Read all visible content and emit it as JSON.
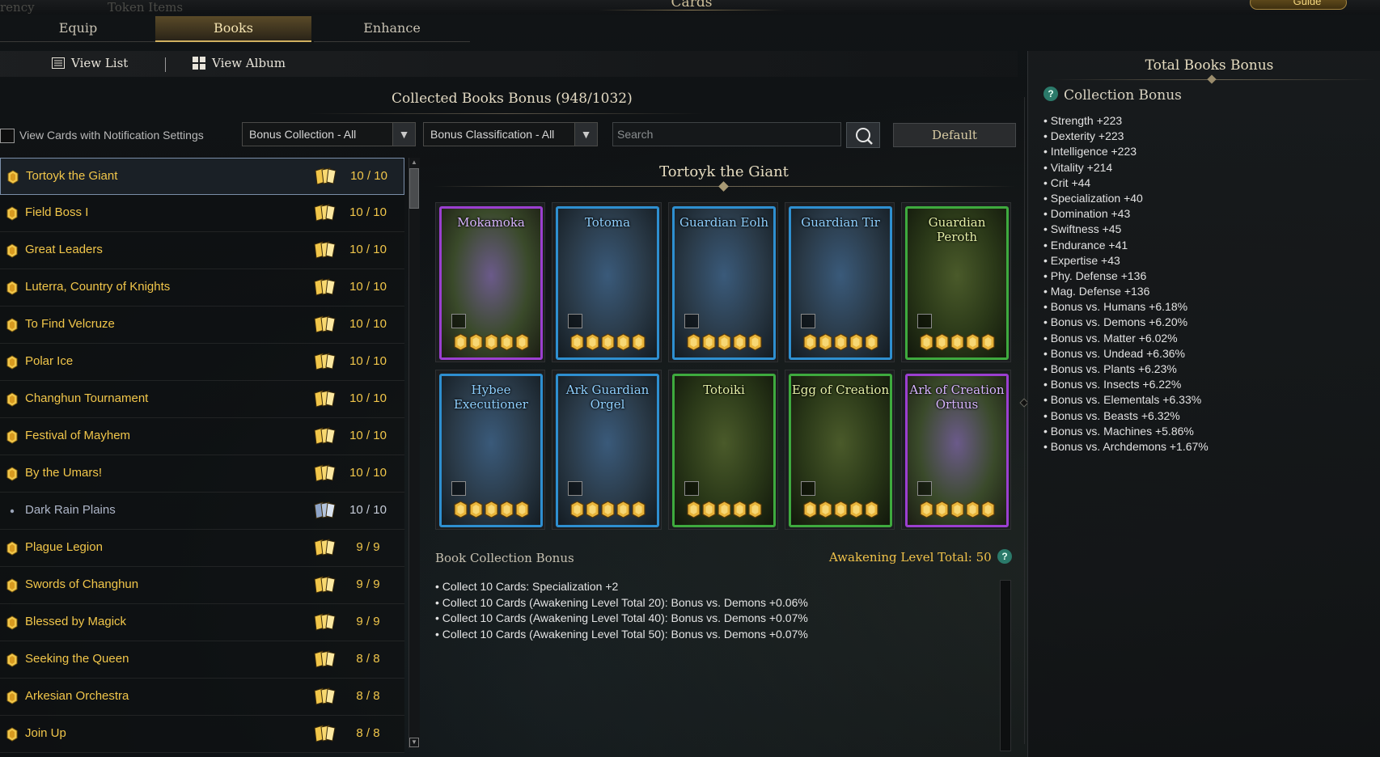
{
  "window": {
    "title": "Cards",
    "guide_label": "Guide",
    "faint_left_1": "rency",
    "faint_left_2": "Token Items"
  },
  "tabs": [
    {
      "label": "Equip",
      "active": false
    },
    {
      "label": "Books",
      "active": true
    },
    {
      "label": "Enhance",
      "active": false
    }
  ],
  "view": {
    "list_label": "View List",
    "album_label": "View Album"
  },
  "collected": {
    "title": "Collected Books Bonus (948/1032)"
  },
  "filters": {
    "notification_label": "View Cards with Notification Settings",
    "bonus_collection": "Bonus Collection - All",
    "bonus_classification": "Bonus Classification - All",
    "search_placeholder": "Search",
    "default_label": "Default"
  },
  "books": [
    {
      "name": "Tortoyk the Giant",
      "count": "10 / 10",
      "selected": true
    },
    {
      "name": "Field Boss I",
      "count": "10 / 10"
    },
    {
      "name": "Great Leaders",
      "count": "10 / 10"
    },
    {
      "name": "Luterra, Country of Knights",
      "count": "10 / 10"
    },
    {
      "name": "To Find Velcruze",
      "count": "10 / 10"
    },
    {
      "name": "Polar Ice",
      "count": "10 / 10"
    },
    {
      "name": "Changhun Tournament",
      "count": "10 / 10"
    },
    {
      "name": "Festival of Mayhem",
      "count": "10 / 10"
    },
    {
      "name": "By the Umars!",
      "count": "10 / 10"
    },
    {
      "name": "Dark Rain Plains",
      "count": "10 / 10",
      "dim": true
    },
    {
      "name": "Plague Legion",
      "count": "9 / 9"
    },
    {
      "name": "Swords of Changhun",
      "count": "9 / 9"
    },
    {
      "name": "Blessed by Magick",
      "count": "9 / 9"
    },
    {
      "name": "Seeking the Queen",
      "count": "8 / 8"
    },
    {
      "name": "Arkesian Orchestra",
      "count": "8 / 8"
    },
    {
      "name": "Join Up",
      "count": "8 / 8"
    }
  ],
  "book_detail": {
    "title": "Tortoyk the Giant",
    "cards": [
      {
        "name": "Mokamoka",
        "grade": "epic",
        "awaken": 5
      },
      {
        "name": "Totoma",
        "grade": "legendary",
        "awaken": 5
      },
      {
        "name": "Guardian Eolh",
        "grade": "legendary",
        "awaken": 5
      },
      {
        "name": "Guardian Tir",
        "grade": "legendary",
        "awaken": 5
      },
      {
        "name": "Guardian Peroth",
        "grade": "relic",
        "awaken": 5
      },
      {
        "name": "Hybee Executioner",
        "grade": "legendary",
        "awaken": 5
      },
      {
        "name": "Ark Guardian Orgel",
        "grade": "legendary",
        "awaken": 5
      },
      {
        "name": "Totoiki",
        "grade": "relic",
        "awaken": 5
      },
      {
        "name": "Egg of Creation",
        "grade": "relic",
        "awaken": 5
      },
      {
        "name": "Ark of Creation Ortuus",
        "grade": "epic",
        "awaken": 5
      }
    ],
    "bonus_label": "Book Collection Bonus",
    "awakening_total": "Awakening Level Total: 50",
    "bonus_lines": [
      "• Collect 10 Cards: Specialization +2",
      "• Collect 10 Cards (Awakening Level Total 20): Bonus vs. Demons +0.06%",
      "• Collect 10 Cards (Awakening Level Total 40): Bonus vs. Demons +0.07%",
      "• Collect 10 Cards (Awakening Level Total 50): Bonus vs. Demons +0.07%"
    ]
  },
  "total_bonus": {
    "title": "Total Books Bonus",
    "help": "?",
    "collection_title": "Collection Bonus",
    "stats": [
      "• Strength +223",
      "• Dexterity +223",
      "• Intelligence +223",
      "• Vitality +214",
      "• Crit +44",
      "• Specialization +40",
      "• Domination +43",
      "• Swiftness +45",
      "• Endurance +41",
      "• Expertise +43",
      "• Phy. Defense +136",
      "• Mag. Defense +136",
      "• Bonus vs. Humans +6.18%",
      "• Bonus vs. Demons +6.20%",
      "• Bonus vs. Matter +6.02%",
      "• Bonus vs. Undead +6.36%",
      "• Bonus vs. Plants +6.23%",
      "• Bonus vs. Insects +6.22%",
      "• Bonus vs. Elementals +6.33%",
      "• Bonus vs. Beasts +6.32%",
      "• Bonus vs. Machines +5.86%",
      "• Bonus vs. Archdemons +1.67%"
    ]
  },
  "colors": {
    "gold_text": "#f1c64a",
    "epic": "#9b3fd0",
    "legendary": "#2e8fd0",
    "relic": "#3eaa3e"
  }
}
